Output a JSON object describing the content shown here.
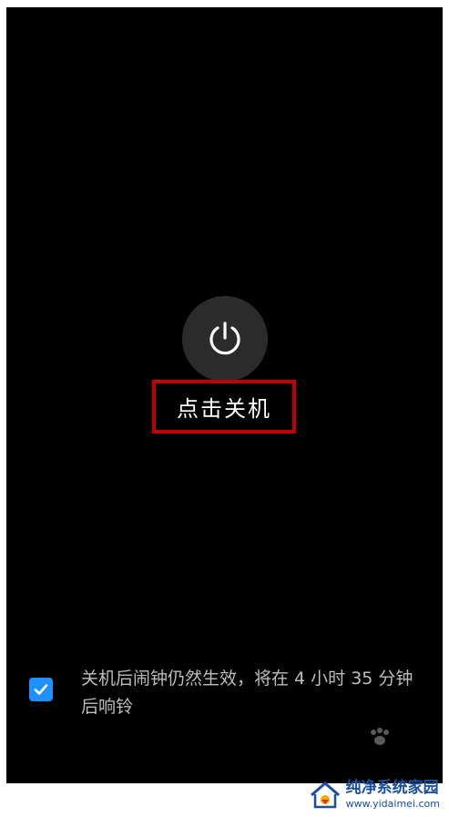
{
  "power_dialog": {
    "power_button_icon": "power-icon",
    "shutdown_label": "点击关机"
  },
  "alarm_notice": {
    "checked": true,
    "text": "关机后闹钟仍然生效，将在 4 小时 35 分钟后响铃"
  },
  "watermark": {
    "title": "纯净系统家园",
    "url": "www.yidaimei.com"
  },
  "colors": {
    "screen_background": "#000000",
    "power_button_background": "#2b2b2b",
    "highlight_border": "#c00000",
    "checkbox_fill": "#1e90ff",
    "notice_text": "#bdbdbd"
  }
}
